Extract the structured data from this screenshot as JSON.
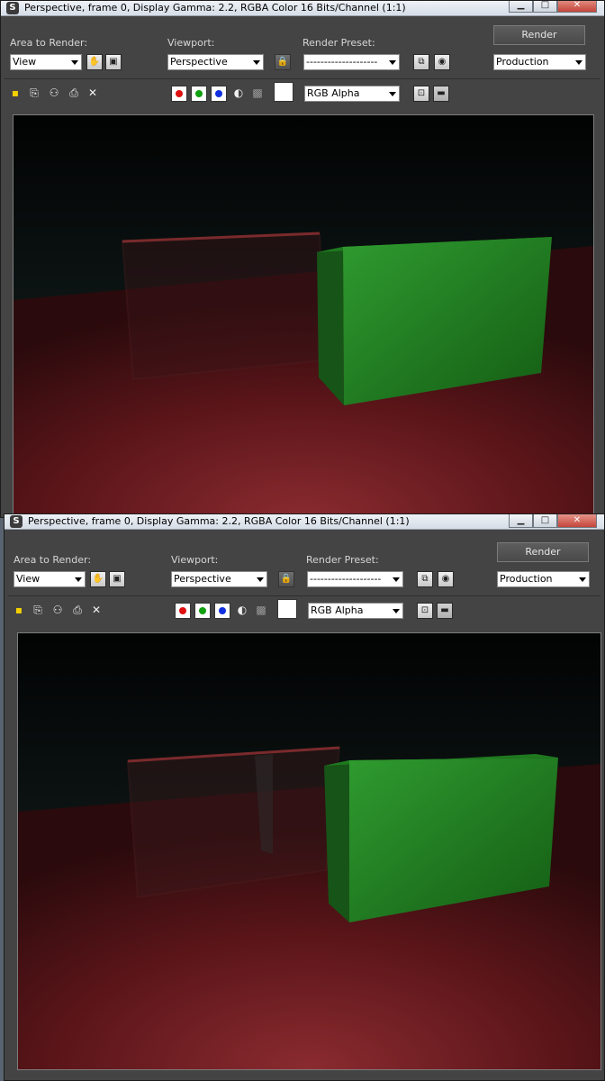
{
  "windows": [
    {
      "title": "Perspective, frame 0, Display Gamma: 2.2, RGBA Color 16 Bits/Channel (1:1)",
      "area_label": "Area to Render:",
      "area_value": "View",
      "viewport_label": "Viewport:",
      "viewport_value": "Perspective",
      "preset_label": "Render Preset:",
      "preset_value": "--------------------",
      "render_label": "Render",
      "mode_value": "Production",
      "channel_value": "RGB Alpha"
    },
    {
      "title": "Perspective, frame 0, Display Gamma: 2.2, RGBA Color 16 Bits/Channel (1:1)",
      "area_label": "Area to Render:",
      "area_value": "View",
      "viewport_label": "Viewport:",
      "viewport_value": "Perspective",
      "preset_label": "Render Preset:",
      "preset_value": "--------------------",
      "render_label": "Render",
      "mode_value": "Production",
      "channel_value": "RGB Alpha"
    }
  ],
  "icons": {
    "app": "3ds-max-app-icon",
    "minimize": "minimize-icon",
    "maximize": "maximize-icon",
    "close": "close-icon",
    "save": "save-icon",
    "copy": "copy-icon",
    "clone": "clone-window-icon",
    "print": "print-icon",
    "clear": "clear-icon",
    "lock": "lock-icon",
    "red_channel": "red-channel-icon",
    "green_channel": "green-channel-icon",
    "blue_channel": "blue-channel-icon",
    "mono": "monochrome-icon",
    "alpha": "alpha-icon",
    "color_swatch": "color-swatch",
    "edit_region": "edit-region-icon",
    "auto_region": "auto-region-icon",
    "render_setup": "render-setup-icon",
    "env_effects": "environment-effects-icon",
    "frame_window": "frame-window-icon",
    "display_toggle": "display-toggle-icon"
  },
  "colors": {
    "frame_bg": "#444444",
    "floor": "#6b1a1e",
    "box_green": "#2f8a2f",
    "channel_red": "#e01010",
    "channel_green": "#10a010",
    "channel_blue": "#1030e0"
  }
}
